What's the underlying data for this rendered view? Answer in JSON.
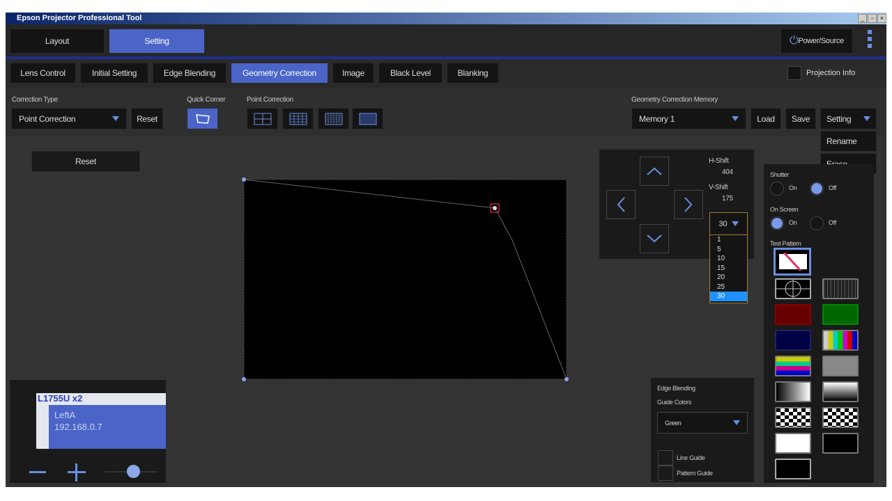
{
  "window": {
    "title": "Epson Projector Professional Tool",
    "controls": [
      "_",
      "▫",
      "×"
    ]
  },
  "header": {
    "tabs": [
      {
        "label": "Layout",
        "active": false
      },
      {
        "label": "Setting",
        "active": true
      }
    ],
    "power_label": "Power/Source"
  },
  "subtabs": [
    {
      "label": "Lens Control"
    },
    {
      "label": "Initial Setting"
    },
    {
      "label": "Edge Blending"
    },
    {
      "label": "Geometry Correction",
      "active": true
    },
    {
      "label": "Image"
    },
    {
      "label": "Black Level"
    },
    {
      "label": "Blanking"
    }
  ],
  "projection_info": {
    "label": "Projection Info",
    "checked": false
  },
  "toolbar": {
    "correction_type_label": "Correction Type",
    "correction_type_value": "Point Correction",
    "reset": "Reset",
    "quick_corner_label": "Quick Corner",
    "point_correction_label": "Point Correction",
    "memory_label": "Geometry Correction Memory",
    "memory_value": "Memory 1",
    "load": "Load",
    "save": "Save",
    "setting": "Setting",
    "setting_menu": [
      "Rename",
      "Erase"
    ]
  },
  "main": {
    "reset": "Reset"
  },
  "shift": {
    "h_label": "H-Shift",
    "h_value": "404",
    "v_label": "V-Shift",
    "v_value": "175",
    "step_value": "30",
    "step_options": [
      "1",
      "5",
      "10",
      "15",
      "20",
      "25",
      "30"
    ]
  },
  "side": {
    "shutter_label": "Shutter",
    "shutter": "Off",
    "onscreen_label": "On Screen",
    "onscreen": "On",
    "on": "On",
    "off": "Off",
    "test_pattern_label": "Test Pattern"
  },
  "edge": {
    "title": "Edge Blending",
    "guide_colors_label": "Guide Colors",
    "guide_color": "Green",
    "line_guide": "Line Guide",
    "pattern_guide": "Pattern Guide"
  },
  "layout_preview": {
    "group": "L1755U x2",
    "name": "LeftA",
    "ip": "192.168.0.7",
    "zoom_level": 0.55
  },
  "colors": {
    "accent": "#4a64c8",
    "selected_point": "#c0202a"
  }
}
